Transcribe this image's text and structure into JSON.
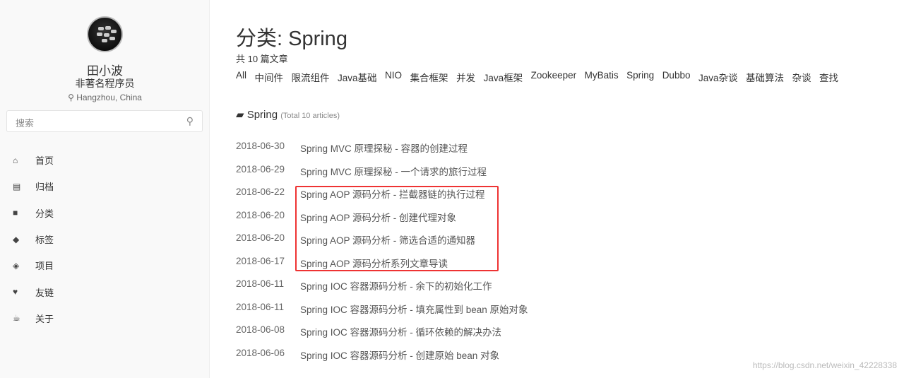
{
  "sidebar": {
    "name": "田小波",
    "bio": "非著名程序员",
    "location": "Hangzhou, China",
    "search_placeholder": "搜索",
    "items": [
      {
        "label": "首页",
        "icon": "home-icon",
        "glyph": "⌂"
      },
      {
        "label": "归档",
        "icon": "archive-icon",
        "glyph": "▤"
      },
      {
        "label": "分类",
        "icon": "folder-icon",
        "glyph": "■"
      },
      {
        "label": "标签",
        "icon": "tags-icon",
        "glyph": "◆"
      },
      {
        "label": "项目",
        "icon": "layers-icon",
        "glyph": "◈"
      },
      {
        "label": "友链",
        "icon": "heart-icon",
        "glyph": "♥"
      },
      {
        "label": "关于",
        "icon": "coffee-icon",
        "glyph": "☕"
      }
    ]
  },
  "main": {
    "title": "分类: Spring",
    "count": "共 10 篇文章",
    "categories": [
      "All",
      "中间件",
      "限流组件",
      "Java基础",
      "NIO",
      "集合框架",
      "并发",
      "Java框架",
      "Zookeeper",
      "MyBatis",
      "Spring",
      "Dubbo",
      "Java杂谈",
      "基础算法",
      "杂谈",
      "查找"
    ],
    "category_name": "Spring",
    "category_total": "(Total 10 articles)",
    "posts": [
      {
        "date": "2018-06-30",
        "title": "Spring MVC 原理探秘 - 容器的创建过程"
      },
      {
        "date": "2018-06-29",
        "title": "Spring MVC 原理探秘 - 一个请求的旅行过程"
      },
      {
        "date": "2018-06-22",
        "title": "Spring AOP 源码分析 - 拦截器链的执行过程"
      },
      {
        "date": "2018-06-20",
        "title": "Spring AOP 源码分析 - 创建代理对象"
      },
      {
        "date": "2018-06-20",
        "title": "Spring AOP 源码分析 - 筛选合适的通知器"
      },
      {
        "date": "2018-06-17",
        "title": "Spring AOP 源码分析系列文章导读"
      },
      {
        "date": "2018-06-11",
        "title": "Spring IOC 容器源码分析 - 余下的初始化工作"
      },
      {
        "date": "2018-06-11",
        "title": "Spring IOC 容器源码分析 - 填充属性到 bean 原始对象"
      },
      {
        "date": "2018-06-08",
        "title": "Spring IOC 容器源码分析 - 循环依赖的解决办法"
      },
      {
        "date": "2018-06-06",
        "title": "Spring IOC 容器源码分析 - 创建原始 bean 对象"
      }
    ]
  },
  "watermark": "https://blog.csdn.net/weixin_42228338",
  "colors": {
    "highlight": "#ee3333"
  }
}
